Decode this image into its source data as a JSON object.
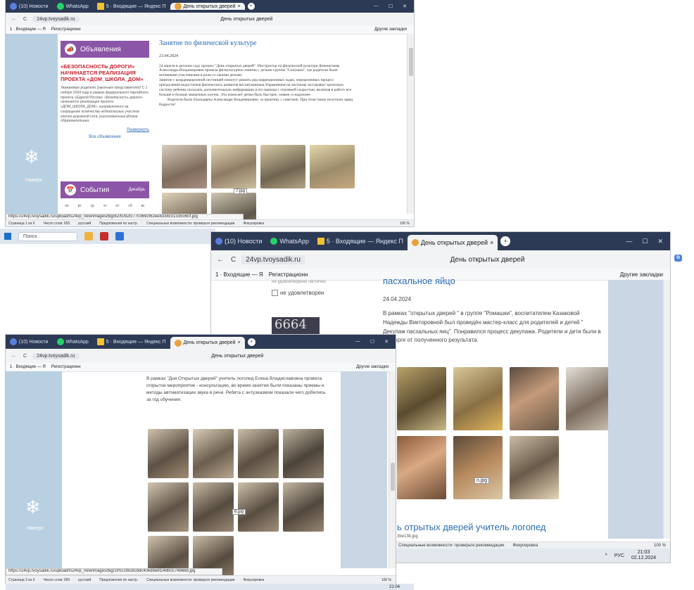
{
  "browser": {
    "tabs": [
      {
        "label": "(10) Новости",
        "color": "#5b7fe0"
      },
      {
        "label": "WhatsApp",
        "color": "#25d366"
      },
      {
        "label": "5 · Входящие — Яндекс П",
        "color": "#f1c232"
      },
      {
        "label": "День открытых дверей",
        "color": "#e9a23b"
      }
    ],
    "tab_close": "×",
    "new_tab": "+",
    "url": "24vp.tvoysadik.ru",
    "page_title": "День открытых дверей",
    "bookmarks": [
      "1 · Входящие — Я",
      "Регистрационн"
    ],
    "bookmarks_right": "Другие закладки",
    "back": "←",
    "reload": "C",
    "window_controls": [
      "—",
      "☐",
      "✕"
    ]
  },
  "sidebar": {
    "label": "Навеpх"
  },
  "window1": {
    "announcements_title": "Объявления",
    "announcement_headline": "«БЕЗОПАСНОСТЬ ДОРОГИ» НАЧИНАЕТСЯ РЕАЛИЗАЦИЯ ПРОЕКТА «ДОМ_ШКОЛА_ДОМ»",
    "announcement_text": "Уважаемые родители (законные представители)! С 1 ноября 2024 года в рамках федерального партийного проекта «Единой России» «Безопасность дороги» начинается реализация проекта «ДОМ_ШКОЛА_ДОМ», направленного на сокращение количества небезопасных участков улично-дорожной сети, расположенных вблизи образовательных",
    "expand": "Развернуть",
    "all_announcements": "Все объявления",
    "events_title": "События",
    "month": "Декабрь",
    "weekdays": [
      "пн",
      "вт",
      "ср",
      "чт",
      "пт",
      "сб",
      "вс"
    ],
    "article_title": "Занятие по физической культуре",
    "article_date": "23.04.2024",
    "article_p1": "24 апреля в детском саду прошел \"День открытых дверей\". Инструктор по физической культуре Деменьтьева Александра Владимировна провела физкультурное занятие с детьми группы \"Сонушки\", где родители были активными участниками в роли со своими детьми.",
    "article_p2": "Занятие с координационной лестницей помогут решить ряд коррекционных задач, определенных процесс преодоления недостатков физического развития воспитанников.Упражнения на лестнице заставляют зрительно систему ребенка посылать дополнительную информацию в его мышцы с огромной скоростью, включая в работу все больше и больше мышечных клеток. Это помогает детям быть быстрее, ловкее, и надежнее.",
    "article_p3": "Родители были благодарны Александре Владимировне, за практику с советами. При этом также получили заряд бодрости!",
    "tooltip": "7.jpg",
    "status_url": "https://24vp.tvoysadik.ru/upload/ts24vp_new/images/big/82/fc/82fc770369cf62ee8338c01335060f.jpg",
    "status_items": [
      "Страница 1 из 6",
      "Число слов: 655",
      "русский",
      "Предложения по настр.",
      "Специальные возможности: проверьте рекомендации",
      "Фокусировка",
      "100 %"
    ]
  },
  "taskbar1": {
    "search": "Поиск"
  },
  "window2": {
    "left_option_prev": "не удовлетворено частично",
    "left_option": "не удовлетворен",
    "captcha": "6664",
    "article_title": "пасхальное яйцо",
    "article_date": "24.04.2024",
    "article_text": "В рамках \"открытых дверей \" в группе \"Ромашки\", воспитателем Казаковой Надежды Викторовной был проведён мастер-класс для родителей и детей \" Декупаж пасхальных яиц\". Понравился процесс декупажа. Родители и дети были в восторге от полученного результата.",
    "tooltip": "n.jpg",
    "next_title": "ь отрытых дверей учитель логопед",
    "file_stub": "3be13b.jpg",
    "status_items": [
      "Специальные возможности: проверьте рекомендации",
      "Фокусировка",
      "100 %"
    ],
    "tray_lang": "РУС",
    "time": "21:03",
    "date": "02.12.2024"
  },
  "window3": {
    "article_text": "В рамках \"Дня Открытых дверей\" учитель логопед Елена Владиславовна провела открытое мероприятие - консультацию, во время занятия были показаны приемы и методы автоматизации звука в речи. Ребята с энтузиазмом показали чего добились за год обучения.",
    "tooltip": "6.jpg",
    "status_url": "https://24vp.tvoysadik.ru/upload/ts24vp_new/images/big/1f/fc/1f8c81bdc40ed8e8f248b0c74b66b.jpg",
    "status_items": [
      "Страница 3 из 6",
      "Число слов: 655",
      "русский",
      "Предложения по настр.",
      "Специальные возможности: проверьте рекомендации",
      "Фокусировка",
      "100 %"
    ],
    "bottom_time": "21:04"
  },
  "colors": {
    "tabbar": "#2d3a55",
    "sidebar": "#b8d0e2",
    "accent_purple": "#8b55a8",
    "link_blue": "#2c6db3",
    "headline_red": "#c8202a"
  }
}
